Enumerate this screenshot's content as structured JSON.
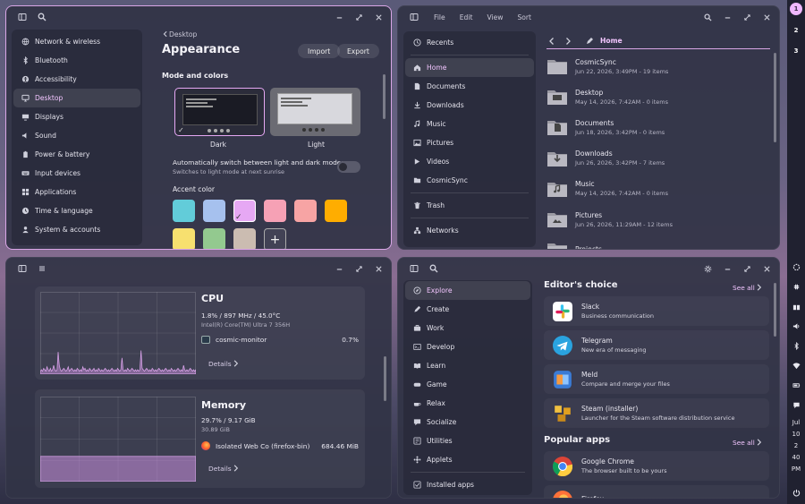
{
  "settings": {
    "sidebar": [
      {
        "label": "Network & wireless",
        "icon": "network-icon"
      },
      {
        "label": "Bluetooth",
        "icon": "bluetooth-icon"
      },
      {
        "label": "Accessibility",
        "icon": "accessibility-icon"
      },
      {
        "label": "Desktop",
        "icon": "desktop-icon"
      },
      {
        "label": "Displays",
        "icon": "display-icon"
      },
      {
        "label": "Sound",
        "icon": "sound-icon"
      },
      {
        "label": "Power & battery",
        "icon": "battery-icon"
      },
      {
        "label": "Input devices",
        "icon": "keyboard-icon"
      },
      {
        "label": "Applications",
        "icon": "applications-icon"
      },
      {
        "label": "Time & language",
        "icon": "clock-icon"
      },
      {
        "label": "System & accounts",
        "icon": "accounts-icon"
      }
    ],
    "selected_index": 3,
    "back_label": "Desktop",
    "title": "Appearance",
    "import_label": "Import",
    "export_label": "Export",
    "section_mode": "Mode and colors",
    "dark_label": "Dark",
    "light_label": "Light",
    "auto_title": "Automatically switch between light and dark modes",
    "auto_sub": "Switches to light mode at next sunrise",
    "accent_label": "Accent color",
    "accent_colors": [
      "#62ccd9",
      "#a6c1ee",
      "#e6a8f4",
      "#f6a1b5",
      "#f7a4a4",
      "#ffad00",
      "#f7e06f",
      "#93c98f",
      "#cbbcb1"
    ],
    "add_label": "+"
  },
  "files": {
    "menu": [
      "File",
      "Edit",
      "View",
      "Sort"
    ],
    "sidebar": [
      {
        "label": "Recents",
        "icon": "recents-icon"
      },
      {
        "label": "Home",
        "icon": "home-icon"
      },
      {
        "label": "Documents",
        "icon": "document-icon"
      },
      {
        "label": "Downloads",
        "icon": "download-icon"
      },
      {
        "label": "Music",
        "icon": "music-icon"
      },
      {
        "label": "Pictures",
        "icon": "picture-icon"
      },
      {
        "label": "Videos",
        "icon": "video-icon"
      },
      {
        "label": "CosmicSync",
        "icon": "folder-icon"
      },
      {
        "label": "Trash",
        "icon": "trash-icon"
      },
      {
        "label": "Networks",
        "icon": "networks-icon"
      }
    ],
    "path": "Home",
    "items": [
      {
        "name": "CosmicSync",
        "meta": "Jun 22, 2026, 3:49PM - 19 items",
        "icon": "folder-icon"
      },
      {
        "name": "Desktop",
        "meta": "May 14, 2026, 7:42AM - 0 items",
        "icon": "folder-desktop-icon"
      },
      {
        "name": "Documents",
        "meta": "Jun 18, 2026, 3:42PM - 0 items",
        "icon": "folder-documents-icon"
      },
      {
        "name": "Downloads",
        "meta": "Jun 26, 2026, 3:42PM - 7 items",
        "icon": "folder-downloads-icon"
      },
      {
        "name": "Music",
        "meta": "May 14, 2026, 7:42AM - 0 items",
        "icon": "folder-music-icon"
      },
      {
        "name": "Pictures",
        "meta": "Jun 26, 2026, 11:29AM - 12 items",
        "icon": "folder-pictures-icon"
      },
      {
        "name": "Projects",
        "meta": "",
        "icon": "folder-icon"
      }
    ]
  },
  "monitor": {
    "cpu": {
      "title": "CPU",
      "stats": "1.8% / 897 MHz / 45.0°C",
      "model": "Intel(R) Core(TM) Ultra 7 356H",
      "proc": "cosmic-monitor",
      "proc_val": "0.7%",
      "details": "Details",
      "spikes": [
        2,
        3,
        2,
        4,
        3,
        2,
        5,
        3,
        2,
        4,
        2,
        3,
        6,
        3,
        2,
        3,
        15,
        6,
        3,
        2,
        3,
        4,
        3,
        2,
        3,
        5,
        2,
        3,
        4,
        3,
        2,
        3,
        2,
        4,
        3,
        2,
        3,
        2,
        5,
        3,
        4,
        2,
        3,
        2,
        4,
        3,
        2,
        3,
        4,
        2,
        3,
        2,
        4,
        3,
        2,
        3,
        2,
        3,
        4,
        3,
        2,
        3,
        2,
        3,
        4,
        3,
        2,
        3,
        2,
        4,
        3,
        2,
        3,
        11,
        3,
        2,
        3,
        2,
        4,
        3,
        2,
        3,
        4,
        3,
        2,
        3,
        2,
        3,
        2,
        3,
        16,
        4,
        3,
        2,
        3,
        4,
        3,
        2,
        3,
        2,
        4,
        3,
        2,
        3,
        2,
        3,
        4,
        3,
        2,
        3,
        2,
        3,
        4,
        3,
        2,
        3,
        2,
        4,
        3,
        2,
        3,
        2,
        3,
        4,
        3,
        2,
        3,
        2,
        6,
        3,
        2,
        3,
        2,
        3,
        4,
        3,
        2,
        3,
        2,
        3
      ]
    },
    "memory": {
      "title": "Memory",
      "stats": "29.7% / 9.17 GiB",
      "total": "30.89 GiB",
      "proc": "Isolated Web Co (firefox-bin)",
      "proc_val": "684.46 MiB",
      "details": "Details",
      "usage_pct": 29.7
    }
  },
  "store": {
    "sidebar": [
      {
        "label": "Explore",
        "icon": "explore-icon"
      },
      {
        "label": "Create",
        "icon": "create-icon"
      },
      {
        "label": "Work",
        "icon": "work-icon"
      },
      {
        "label": "Develop",
        "icon": "develop-icon"
      },
      {
        "label": "Learn",
        "icon": "learn-icon"
      },
      {
        "label": "Game",
        "icon": "game-icon"
      },
      {
        "label": "Relax",
        "icon": "relax-icon"
      },
      {
        "label": "Socialize",
        "icon": "socialize-icon"
      },
      {
        "label": "Utilities",
        "icon": "utilities-icon"
      },
      {
        "label": "Applets",
        "icon": "applets-icon"
      },
      {
        "label": "Installed apps",
        "icon": "installed-icon"
      }
    ],
    "editors_title": "Editor's choice",
    "see_all": "See all",
    "editors": [
      {
        "name": "Slack",
        "desc": "Business communication",
        "icon": "slack-icon"
      },
      {
        "name": "Telegram",
        "desc": "New era of messaging",
        "icon": "telegram-icon"
      },
      {
        "name": "Meld",
        "desc": "Compare and merge your files",
        "icon": "meld-icon"
      },
      {
        "name": "Steam (installer)",
        "desc": "Launcher for the Steam software distribution service",
        "icon": "steam-icon"
      }
    ],
    "popular_title": "Popular apps",
    "popular": [
      {
        "name": "Google Chrome",
        "desc": "The browser built to be yours",
        "icon": "chrome-icon"
      },
      {
        "name": "Firefox",
        "desc": "",
        "icon": "firefox-icon"
      }
    ]
  },
  "panel": {
    "workspaces": [
      "1",
      "2",
      "3"
    ],
    "clock": [
      "Jul",
      "10",
      "2",
      "40",
      "PM"
    ]
  }
}
